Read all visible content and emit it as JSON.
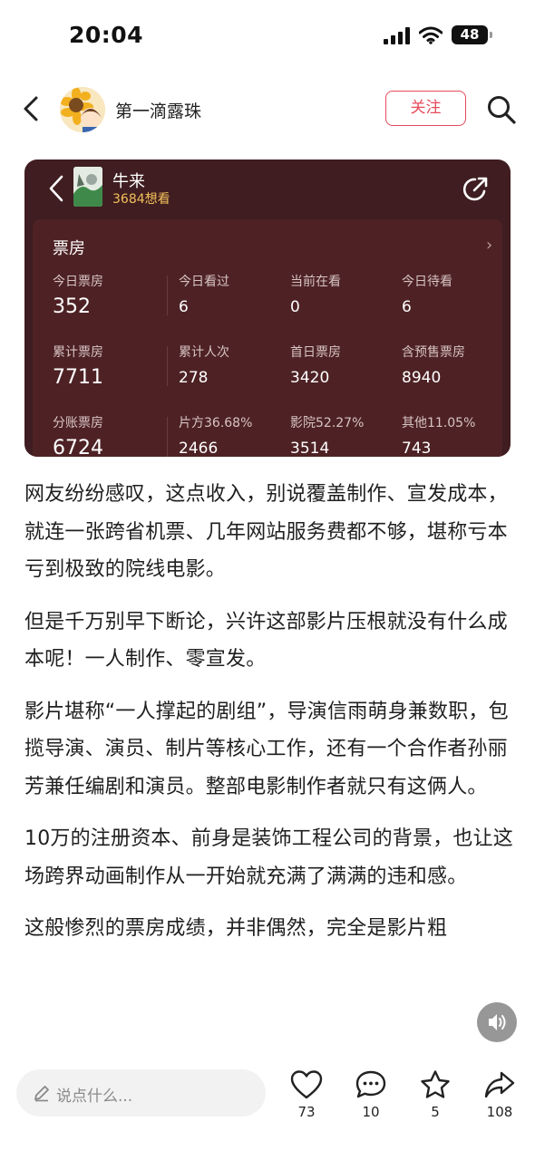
{
  "status_bar": {
    "time": "20:04",
    "battery": "48"
  },
  "header": {
    "author_name": "第一滴露珠",
    "follow_label": "关注"
  },
  "movie_card": {
    "title": "牛来",
    "want_to_see": "3684想看",
    "box_office_title": "票房",
    "rows": [
      [
        {
          "label": "今日票房",
          "value": "352"
        },
        {
          "label": "今日看过",
          "value": "6"
        },
        {
          "label": "当前在看",
          "value": "0"
        },
        {
          "label": "今日待看",
          "value": "6"
        }
      ],
      [
        {
          "label": "累计票房",
          "value": "7711"
        },
        {
          "label": "累计人次",
          "value": "278"
        },
        {
          "label": "首日票房",
          "value": "3420"
        },
        {
          "label": "含预售票房",
          "value": "8940"
        }
      ],
      [
        {
          "label": "分账票房",
          "value": "6724"
        },
        {
          "label": "片方36.68%",
          "value": "2466"
        },
        {
          "label": "影院52.27%",
          "value": "3514"
        },
        {
          "label": "其他11.05%",
          "value": "743"
        }
      ]
    ]
  },
  "article": {
    "paragraphs": [
      "网友纷纷感叹，这点收入，别说覆盖制作、宣发成本，就连一张跨省机票、几年网站服务费都不够，堪称亏本亏到极致的院线电影。",
      "但是千万别早下断论，兴许这部影片压根就没有什么成本呢！一人制作、零宣发。",
      "影片堪称“一人撑起的剧组”，导演信雨萌身兼数职，包揽导演、演员、制片等核心工作，还有一个合作者孙丽芳兼任编剧和演员。整部电影制作者就只有这俩人。",
      "10万的注册资本、前身是装饰工程公司的背景，也让这场跨界动画制作从一开始就充满了满满的违和感。",
      "这般惨烈的票房成绩，并非偶然，完全是影片粗"
    ]
  },
  "bottom_bar": {
    "comment_placeholder": "说点什么...",
    "like_count": "73",
    "comment_count": "10",
    "star_count": "5",
    "share_count": "108"
  }
}
